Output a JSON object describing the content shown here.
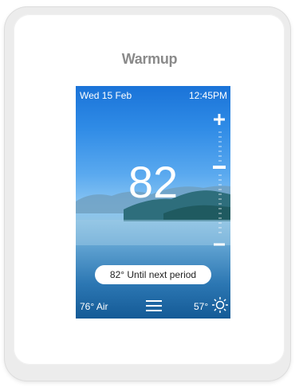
{
  "brand": {
    "name": "Warmup"
  },
  "status_bar": {
    "date": "Wed 15 Feb",
    "time": "12:45PM"
  },
  "setpoint": {
    "value": "82"
  },
  "schedule": {
    "label": "82° Until next period"
  },
  "footer": {
    "air_temp": "76° Air",
    "outdoor_temp": "57°"
  },
  "icons": [
    "plus-icon",
    "minus-icon",
    "menu-icon",
    "sun-icon"
  ]
}
